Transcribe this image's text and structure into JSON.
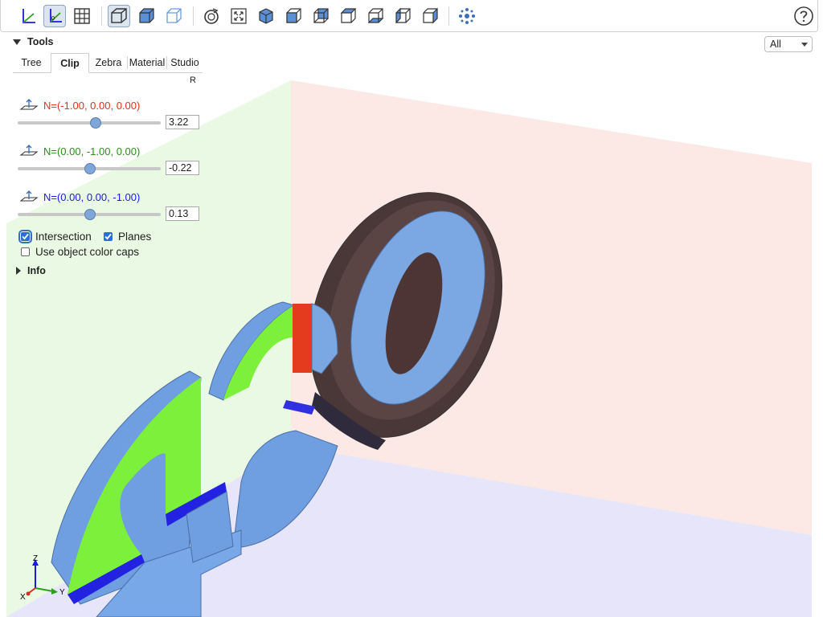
{
  "toolbar": {
    "buttons": [
      {
        "name": "axes-icon",
        "active": false
      },
      {
        "name": "axes-origin-icon",
        "active": true
      },
      {
        "name": "grid-icon",
        "active": false
      },
      {
        "name": "perspective-icon",
        "active": true
      },
      {
        "name": "solid-cube-icon",
        "active": false
      },
      {
        "name": "wireframe-cube-icon",
        "active": false
      },
      {
        "name": "reset-view-icon",
        "active": false
      },
      {
        "name": "fit-view-icon",
        "active": false
      },
      {
        "name": "iso-view-icon",
        "active": false
      },
      {
        "name": "front-view-icon",
        "active": false
      },
      {
        "name": "rear-view-icon",
        "active": false
      },
      {
        "name": "top-view-icon",
        "active": false
      },
      {
        "name": "bottom-view-icon",
        "active": false
      },
      {
        "name": "left-view-icon",
        "active": false
      },
      {
        "name": "right-view-icon",
        "active": false
      },
      {
        "name": "explode-icon",
        "active": false
      }
    ],
    "help_icon": "help-icon"
  },
  "panel": {
    "tools_label": "Tools",
    "tabs": [
      "Tree",
      "Clip",
      "Zebra",
      "Material",
      "Studio"
    ],
    "selected_tab": "Clip",
    "r_label": "R",
    "clips": [
      {
        "normal": "N=(-1.00, 0.00, 0.00)",
        "value": "3.22",
        "color": "#e0301e",
        "fraction": 0.54
      },
      {
        "normal": "N=(0.00, -1.00, 0.00)",
        "value": "-0.22",
        "color": "#2e8b1e",
        "fraction": 0.49
      },
      {
        "normal": "N=(0.00, 0.00, -1.00)",
        "value": "0.13",
        "color": "#1a1ae6",
        "fraction": 0.49
      }
    ],
    "intersection_label": "Intersection",
    "intersection_checked": true,
    "planes_label": "Planes",
    "planes_checked": true,
    "caps_label": "Use object color caps",
    "caps_checked": false,
    "info_label": "Info"
  },
  "view_select": {
    "value": "All"
  },
  "triad": {
    "x": "X",
    "y": "Y",
    "z": "Z"
  }
}
